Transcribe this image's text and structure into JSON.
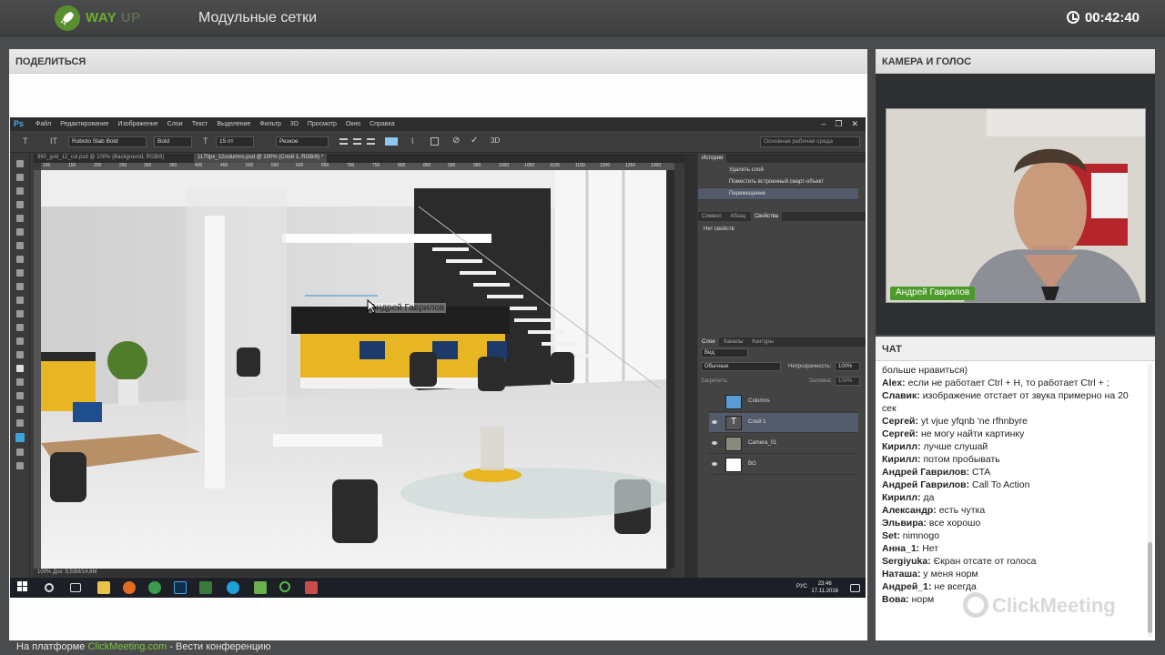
{
  "header": {
    "brand": "WAY",
    "brand_sub": "UP",
    "title": "Модульные сетки",
    "timer": "00:42:40"
  },
  "share_panel": {
    "title": "ПОДЕЛИТЬСЯ",
    "cursor_label": "Андрей Гаврилов",
    "photoshop": {
      "logo": "Ps",
      "menu": [
        "Файл",
        "Редактирование",
        "Изображение",
        "Слои",
        "Текст",
        "Выделение",
        "Фильтр",
        "3D",
        "Просмотр",
        "Окно",
        "Справка"
      ],
      "options": {
        "font_family": "Roboto Slab Bold",
        "font_style": "Bold",
        "font_size": "15 пт",
        "antialias": "Резкое",
        "workspace": "Основная рабочая среда"
      },
      "tabs": [
        {
          "label": "960_grid_12_col.psd @ 100% (Background, RGB/8)"
        },
        {
          "label": "1170px_12columns.psd @ 100% (Слой 1, RGB/8) *"
        }
      ],
      "ruler_marks": [
        "100",
        "150",
        "200",
        "250",
        "300",
        "350",
        "400",
        "450",
        "500",
        "550",
        "600",
        "650",
        "700",
        "750",
        "800",
        "850",
        "900",
        "950",
        "1000",
        "1050",
        "1100",
        "1150",
        "1200",
        "1250",
        "1300"
      ],
      "history_tabs": [
        "История"
      ],
      "history_items": [
        "Удалить слой",
        "Поместить встроенный смарт-объект",
        "Перемещение"
      ],
      "props_tabs": [
        "Символ",
        "Абзац",
        "Свойства"
      ],
      "props_text": "Нет свойств",
      "layer_tabs": [
        "Слои",
        "Каналы",
        "Контуры"
      ],
      "layer_filter": "Вид",
      "blend_mode": "Обычные",
      "opacity_label": "Непрозрачность:",
      "opacity_value": "100%",
      "lock_label": "Закрепить:",
      "fill_label": "Заливка:",
      "fill_value": "100%",
      "layers": [
        {
          "name": "Columns"
        },
        {
          "name": "Слой 1"
        },
        {
          "name": "Camera_01"
        },
        {
          "name": "BG"
        }
      ],
      "status": "100%     Док: 9,53M/14,6M",
      "tray_lang": "РУС",
      "tray_time": "23:46",
      "tray_date": "17.11.2016"
    }
  },
  "camera_panel": {
    "title": "КАМЕРА И ГОЛОС",
    "presenter": "Андрей Гаврилов"
  },
  "chat_panel": {
    "title": "ЧАТ",
    "messages": [
      {
        "user": "",
        "text": "больше нравиться)"
      },
      {
        "user": "Alex:",
        "text": "если не работает Ctrl + H,  то работает Ctrl + ;"
      },
      {
        "user": "Славик:",
        "text": "изображение отстает от звука примерно на 20 сек"
      },
      {
        "user": "Сергей:",
        "text": "yt vjue yfqnb 'ne rfhnbyre"
      },
      {
        "user": "Сергей:",
        "text": "не могу найти картинку"
      },
      {
        "user": "Кирилл:",
        "text": "лучше слушай"
      },
      {
        "user": "Кирилл:",
        "text": "потом пробывать"
      },
      {
        "user": "Андрей Гаврилов:",
        "text": "CTA"
      },
      {
        "user": "Андрей Гаврилов:",
        "text": "Call To Action"
      },
      {
        "user": "Кирилл:",
        "text": "да"
      },
      {
        "user": "Александр:",
        "text": "есть чутка"
      },
      {
        "user": "Эльвира:",
        "text": "все хорошо"
      },
      {
        "user": "Set:",
        "text": "nimnogo"
      },
      {
        "user": "Анна_1:",
        "text": "Нет"
      },
      {
        "user": "Sergiyuka:",
        "text": "Єкран отсате от голоса"
      },
      {
        "user": "Наташа:",
        "text": "у меня норм"
      },
      {
        "user": "Андрей_1:",
        "text": "не всегда"
      },
      {
        "user": "Вова:",
        "text": "норм"
      }
    ],
    "watermark": "ClickMeeting"
  },
  "footer": {
    "prefix": "На платформе",
    "link": "ClickMeeting.com",
    "suffix": "- Вести конференцию"
  },
  "colors": {
    "accent_green": "#6fae2c",
    "footer_link": "#7cc243",
    "ps_selection": "#535b6b",
    "background": "#4a4b4c"
  }
}
